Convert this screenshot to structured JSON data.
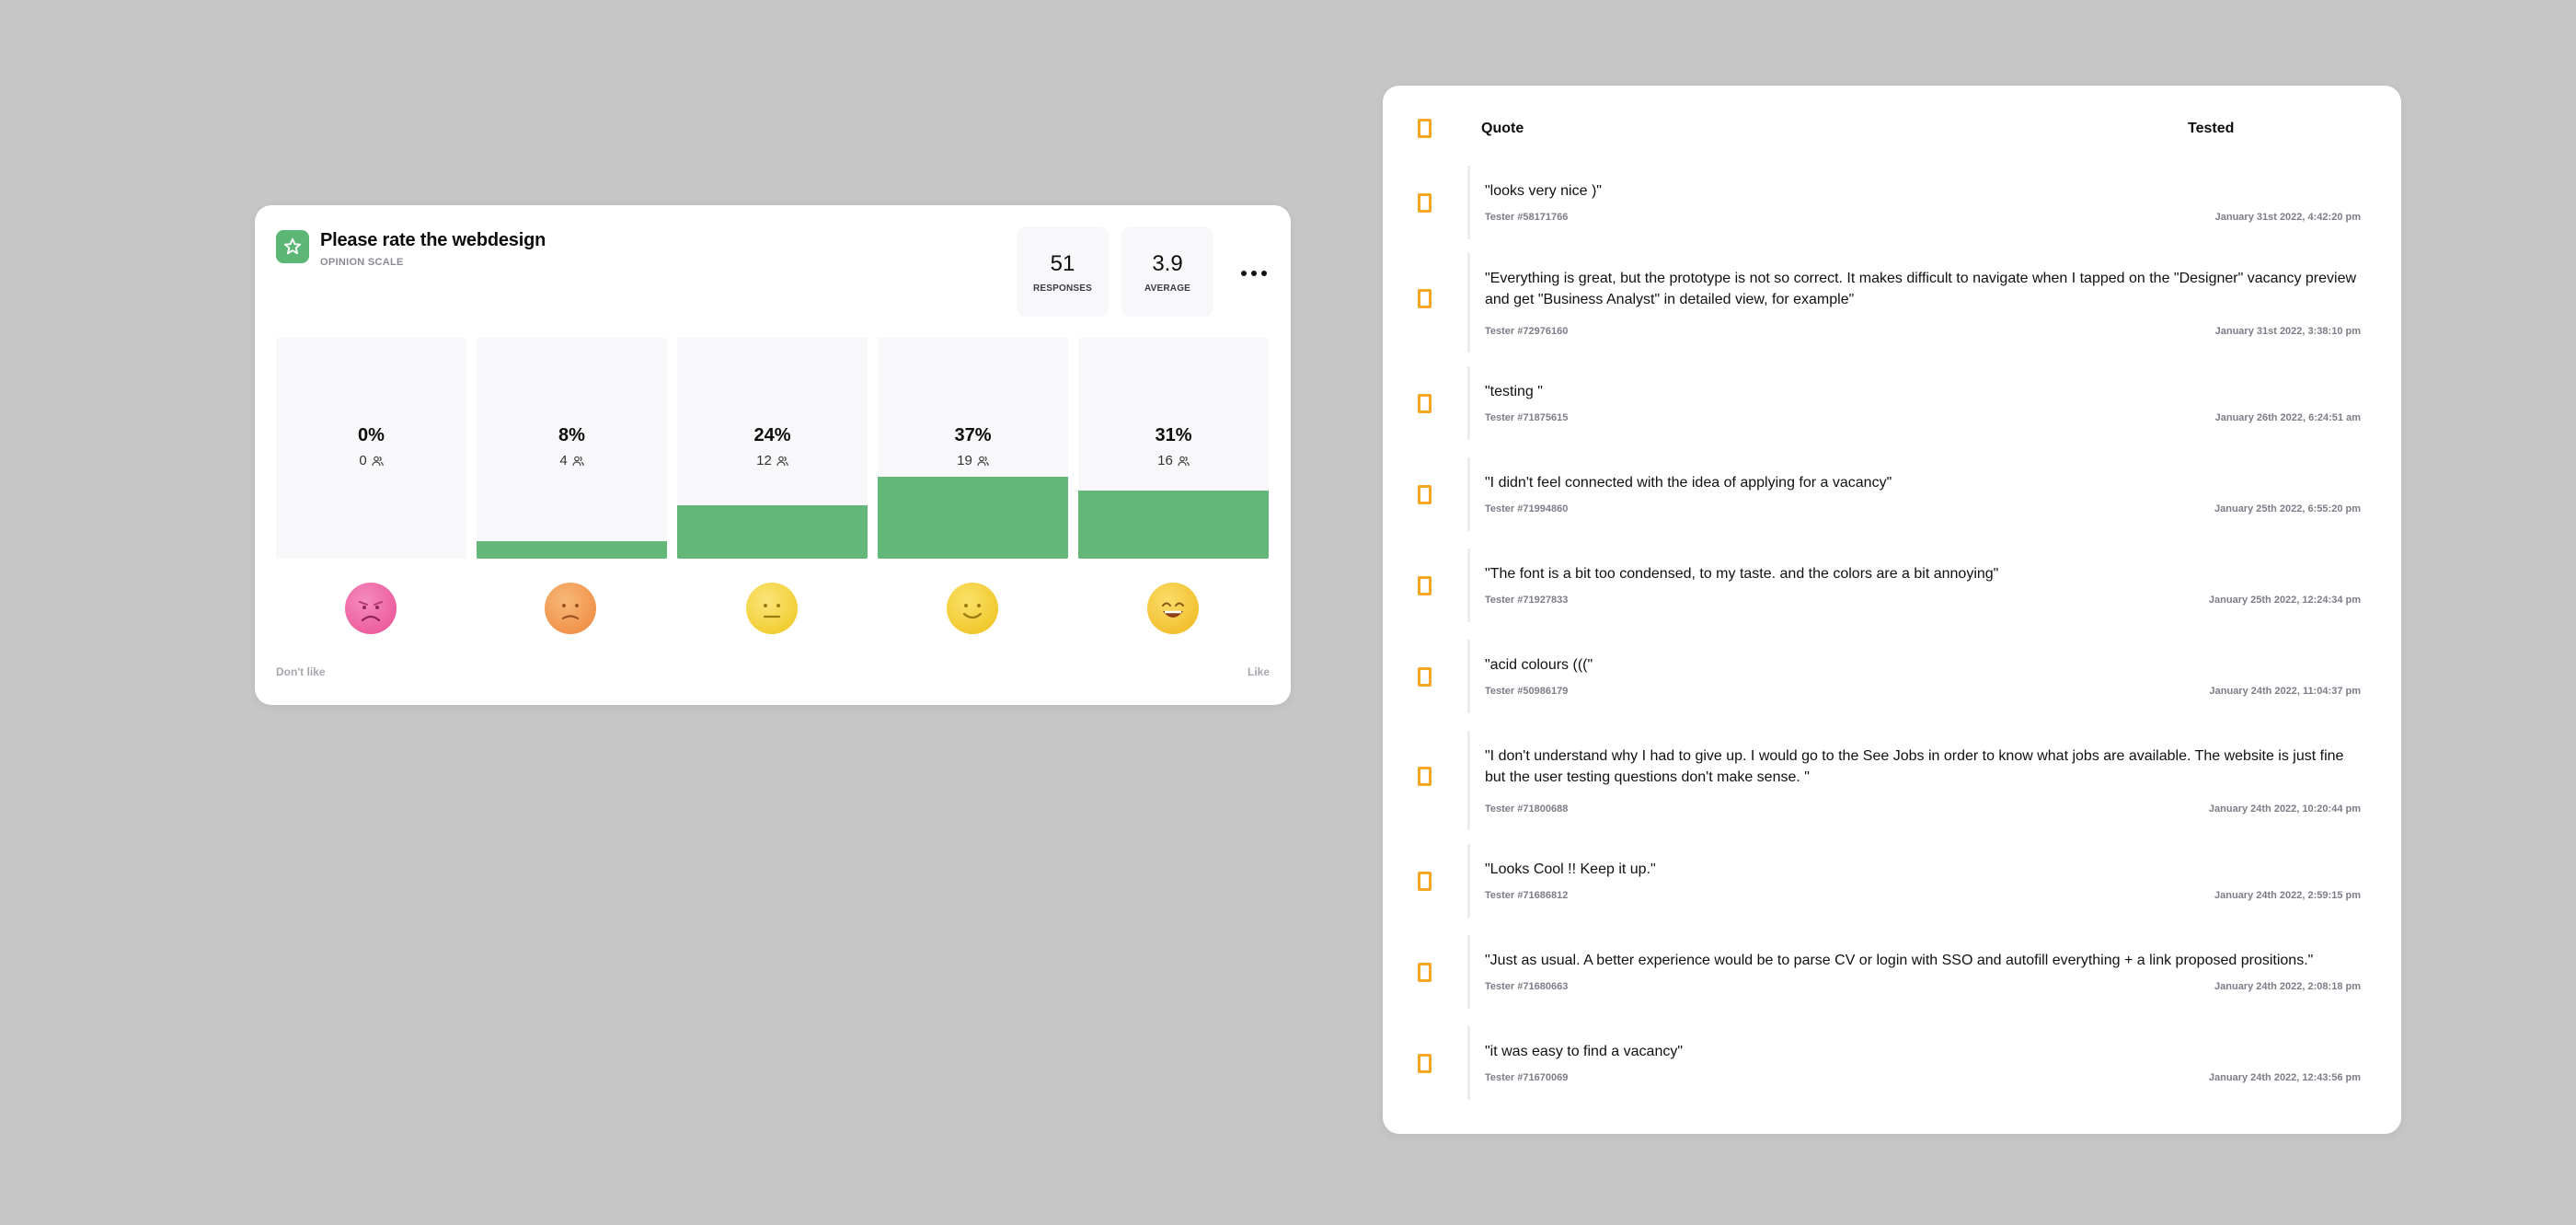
{
  "question": {
    "title": "Please rate the webdesign",
    "type_label": "OPINION SCALE",
    "icon": "star-icon",
    "icon_color": "#5cb777"
  },
  "stats": {
    "responses_value": "51",
    "responses_label": "RESPONSES",
    "average_value": "3.9",
    "average_label": "AVERAGE"
  },
  "more_icon": "more-horizontal-icon",
  "scale": {
    "bar_color": "#63b779",
    "options": [
      {
        "percent": "0%",
        "fraction": 0.0,
        "count": "0",
        "face": "angry-face-icon",
        "face_color": "#f06ba8"
      },
      {
        "percent": "8%",
        "fraction": 0.08,
        "count": "4",
        "face": "frowning-face-icon",
        "face_color": "#f4a04e"
      },
      {
        "percent": "24%",
        "fraction": 0.24,
        "count": "12",
        "face": "neutral-face-icon",
        "face_color": "#f7dc4c"
      },
      {
        "percent": "37%",
        "fraction": 0.37,
        "count": "19",
        "face": "smiling-face-icon",
        "face_color": "#f6d23a"
      },
      {
        "percent": "31%",
        "fraction": 0.31,
        "count": "16",
        "face": "grinning-face-icon",
        "face_color": "#f8c93a"
      }
    ],
    "low_label": "Don't like",
    "high_label": "Like"
  },
  "table": {
    "header_quote": "Quote",
    "header_tested": "Tested",
    "checkbox_color": "#f5a623",
    "rows": [
      {
        "quote": "\"looks very nice )\"",
        "tester": "Tester #58171766",
        "date": "January 31st 2022, 4:42:20 pm"
      },
      {
        "quote": "\"Everything is great, but the prototype is not so correct. It makes difficult to navigate when I tapped on the \"Designer\" vacancy preview and get \"Business Analyst\" in detailed view, for example\"",
        "tester": "Tester #72976160",
        "date": "January 31st 2022, 3:38:10 pm"
      },
      {
        "quote": "\"testing \"",
        "tester": "Tester #71875615",
        "date": "January 26th 2022, 6:24:51 am"
      },
      {
        "quote": "\"I didn't feel connected with the idea of applying for a vacancy\"",
        "tester": "Tester #71994860",
        "date": "January 25th 2022, 6:55:20 pm"
      },
      {
        "quote": "\"The font is a bit too condensed, to my taste. and the colors are a bit annoying\"",
        "tester": "Tester #71927833",
        "date": "January 25th 2022, 12:24:34 pm"
      },
      {
        "quote": "\"acid colours (((\"",
        "tester": "Tester #50986179",
        "date": "January 24th 2022, 11:04:37 pm"
      },
      {
        "quote": "\"I don't understand why I had to give up. I would go to the See Jobs in order to know what jobs are available. The website is just fine but the user testing questions don't make sense. \"",
        "tester": "Tester #71800688",
        "date": "January 24th 2022, 10:20:44 pm"
      },
      {
        "quote": "\"Looks Cool !! Keep it up.\"",
        "tester": "Tester #71686812",
        "date": "January 24th 2022, 2:59:15 pm"
      },
      {
        "quote": "\"Just as usual. A better experience would be to parse CV or login with SSO and autofill everything + a link proposed prositions.\"",
        "tester": "Tester #71680663",
        "date": "January 24th 2022, 2:08:18 pm"
      },
      {
        "quote": "\"it was easy to find a vacancy\"",
        "tester": "Tester #71670069",
        "date": "January 24th 2022, 12:43:56 pm"
      }
    ]
  }
}
